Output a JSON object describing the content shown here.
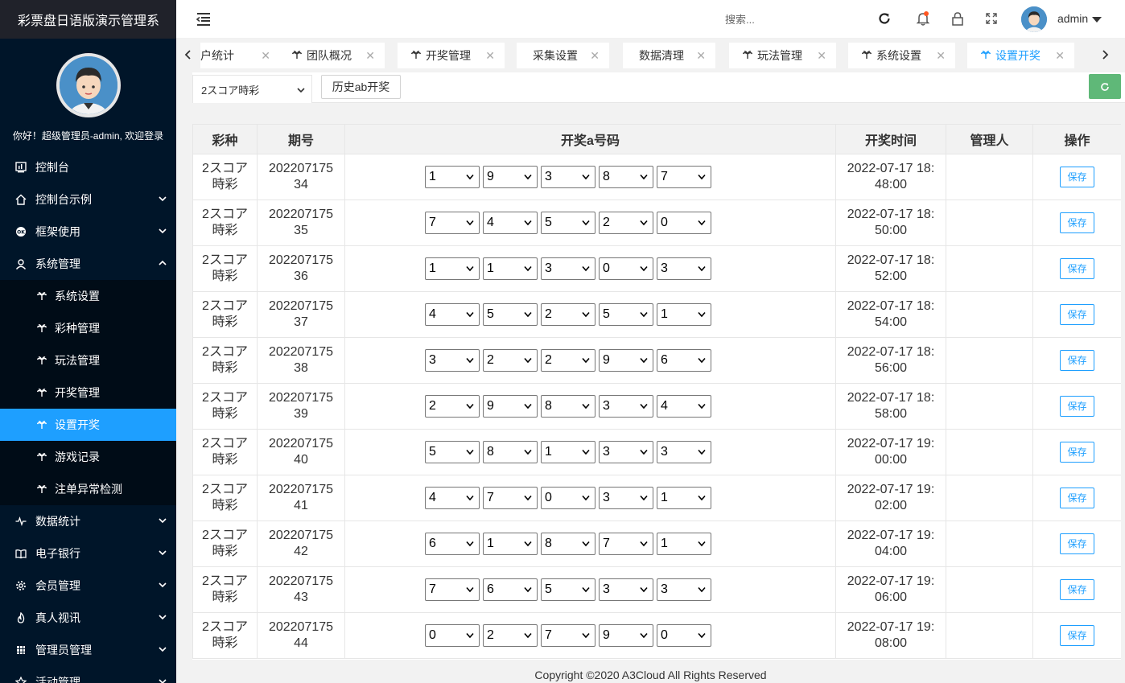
{
  "app": {
    "title": "彩票盘日语版演示管理系"
  },
  "profile": {
    "greeting": "你好！超级管理员-admin, 欢迎登录"
  },
  "sidebar": {
    "items": [
      {
        "label": "控制台",
        "icon": "dashboard-icon"
      },
      {
        "label": "控制台示例",
        "icon": "home-icon"
      },
      {
        "label": "框架使用",
        "icon": "ok-icon"
      },
      {
        "label": "系统管理",
        "icon": "user-icon"
      }
    ],
    "submenu": [
      {
        "label": "系统设置"
      },
      {
        "label": "彩种管理"
      },
      {
        "label": "玩法管理"
      },
      {
        "label": "开奖管理"
      },
      {
        "label": "设置开奖",
        "active": true
      },
      {
        "label": "游戏记录"
      },
      {
        "label": "注单异常检测"
      }
    ],
    "items_after": [
      {
        "label": "数据统计",
        "icon": "pulse-icon"
      },
      {
        "label": "电子银行",
        "icon": "book-icon"
      },
      {
        "label": "会员管理",
        "icon": "gear-icon"
      },
      {
        "label": "真人视讯",
        "icon": "fire-icon"
      },
      {
        "label": "管理员管理",
        "icon": "grid-icon"
      },
      {
        "label": "活动管理",
        "icon": "star-icon"
      }
    ]
  },
  "header": {
    "search_placeholder": "搜索...",
    "username": "admin"
  },
  "tabs": [
    {
      "label": "户统计",
      "icon": false
    },
    {
      "label": "团队概况",
      "icon": true
    },
    {
      "label": "开奖管理",
      "icon": true
    },
    {
      "label": "采集设置",
      "icon": false
    },
    {
      "label": "数据清理",
      "icon": false
    },
    {
      "label": "玩法管理",
      "icon": true
    },
    {
      "label": "系统设置",
      "icon": true
    },
    {
      "label": "设置开奖",
      "icon": true,
      "active": true
    }
  ],
  "toolbar": {
    "lottery_selected": "2スコア時彩",
    "history_button": "历史ab开奖"
  },
  "table": {
    "headers": [
      "彩种",
      "期号",
      "开奖a号码",
      "开奖时间",
      "管理人",
      "操作"
    ],
    "save_label": "保存",
    "rows": [
      {
        "lottery": [
          "2スコア",
          "時彩"
        ],
        "period": [
          "202207175",
          "34"
        ],
        "nums": [
          "1",
          "9",
          "3",
          "8",
          "7"
        ],
        "time": [
          "2022-07-17 18:",
          "48:00"
        ],
        "manager": ""
      },
      {
        "lottery": [
          "2スコア",
          "時彩"
        ],
        "period": [
          "202207175",
          "35"
        ],
        "nums": [
          "7",
          "4",
          "5",
          "2",
          "0"
        ],
        "time": [
          "2022-07-17 18:",
          "50:00"
        ],
        "manager": ""
      },
      {
        "lottery": [
          "2スコア",
          "時彩"
        ],
        "period": [
          "202207175",
          "36"
        ],
        "nums": [
          "1",
          "1",
          "3",
          "0",
          "3"
        ],
        "time": [
          "2022-07-17 18:",
          "52:00"
        ],
        "manager": ""
      },
      {
        "lottery": [
          "2スコア",
          "時彩"
        ],
        "period": [
          "202207175",
          "37"
        ],
        "nums": [
          "4",
          "5",
          "2",
          "5",
          "1"
        ],
        "time": [
          "2022-07-17 18:",
          "54:00"
        ],
        "manager": ""
      },
      {
        "lottery": [
          "2スコア",
          "時彩"
        ],
        "period": [
          "202207175",
          "38"
        ],
        "nums": [
          "3",
          "2",
          "2",
          "9",
          "6"
        ],
        "time": [
          "2022-07-17 18:",
          "56:00"
        ],
        "manager": ""
      },
      {
        "lottery": [
          "2スコア",
          "時彩"
        ],
        "period": [
          "202207175",
          "39"
        ],
        "nums": [
          "2",
          "9",
          "8",
          "3",
          "4"
        ],
        "time": [
          "2022-07-17 18:",
          "58:00"
        ],
        "manager": ""
      },
      {
        "lottery": [
          "2スコア",
          "時彩"
        ],
        "period": [
          "202207175",
          "40"
        ],
        "nums": [
          "5",
          "8",
          "1",
          "3",
          "3"
        ],
        "time": [
          "2022-07-17 19:",
          "00:00"
        ],
        "manager": ""
      },
      {
        "lottery": [
          "2スコア",
          "時彩"
        ],
        "period": [
          "202207175",
          "41"
        ],
        "nums": [
          "4",
          "7",
          "0",
          "3",
          "1"
        ],
        "time": [
          "2022-07-17 19:",
          "02:00"
        ],
        "manager": ""
      },
      {
        "lottery": [
          "2スコア",
          "時彩"
        ],
        "period": [
          "202207175",
          "42"
        ],
        "nums": [
          "6",
          "1",
          "8",
          "7",
          "1"
        ],
        "time": [
          "2022-07-17 19:",
          "04:00"
        ],
        "manager": ""
      },
      {
        "lottery": [
          "2スコア",
          "時彩"
        ],
        "period": [
          "202207175",
          "43"
        ],
        "nums": [
          "7",
          "6",
          "5",
          "3",
          "3"
        ],
        "time": [
          "2022-07-17 19:",
          "06:00"
        ],
        "manager": ""
      },
      {
        "lottery": [
          "2スコア",
          "時彩"
        ],
        "period": [
          "202207175",
          "44"
        ],
        "nums": [
          "0",
          "2",
          "7",
          "9",
          "0"
        ],
        "time": [
          "2022-07-17 19:",
          "08:00"
        ],
        "manager": ""
      }
    ]
  },
  "footer": {
    "copyright": "Copyright ©2020 A3Cloud All Rights Reserved"
  },
  "colors": {
    "sidebar_bg": "#001529",
    "active": "#1e9fff",
    "refresh": "#5fb878"
  }
}
